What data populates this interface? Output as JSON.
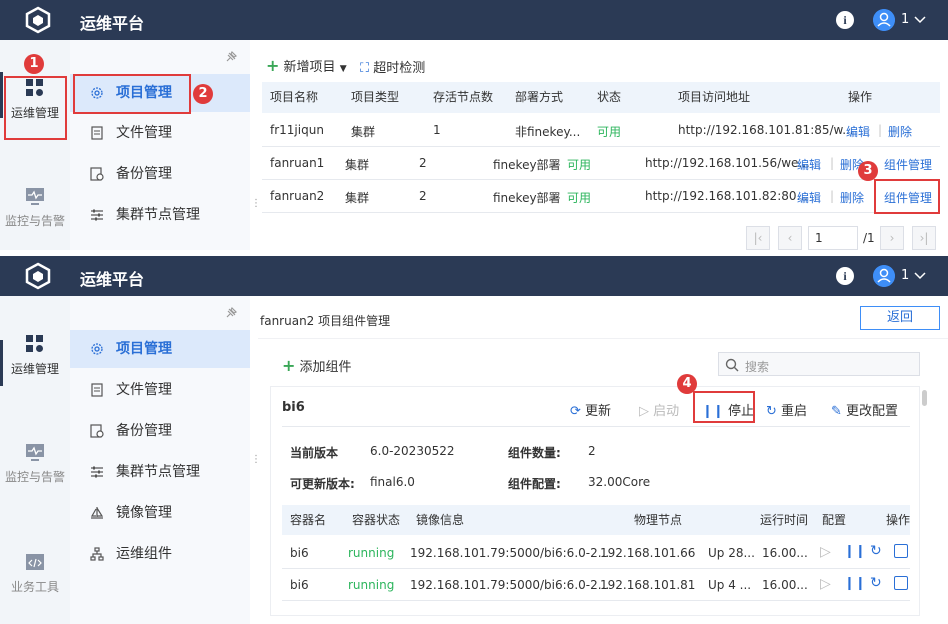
{
  "app": {
    "title": "运维平台",
    "user": "1",
    "info_icon": "info-icon",
    "avatar_icon": "user-avatar-icon"
  },
  "colors": {
    "header_bg": "#2b3a55",
    "accent": "#2a6fd6",
    "running": "#2db55d",
    "annotation": "#e03b3b"
  },
  "nav1": {
    "ops": "运维管理",
    "monitor": "监控与告警",
    "tools": "业务工具"
  },
  "nav2_top": [
    "项目管理",
    "文件管理",
    "备份管理",
    "集群节点管理"
  ],
  "nav2_bottom": [
    "项目管理",
    "文件管理",
    "备份管理",
    "集群节点管理",
    "镜像管理",
    "运维组件"
  ],
  "projects": {
    "new_label": "新增项目",
    "timeout_label": "超时检测",
    "headers": [
      "项目名称",
      "项目类型",
      "存活节点数",
      "部署方式",
      "状态",
      "项目访问地址",
      "操作"
    ],
    "rows": [
      {
        "name": "fr11jiqun",
        "type": "集群",
        "nodes": "1",
        "deploy": "非finekey...",
        "status": "可用",
        "url": "http://192.168.101.81:85/w...",
        "edit": "编辑",
        "delete": "删除"
      },
      {
        "name": "fanruan1",
        "type": "集群",
        "nodes": "2",
        "deploy": "finekey部署",
        "status": "可用",
        "url": "http://192.168.101.56/we...",
        "edit": "编辑",
        "delete": "删除",
        "component": "组件管理"
      },
      {
        "name": "fanruan2",
        "type": "集群",
        "nodes": "2",
        "deploy": "finekey部署",
        "status": "可用",
        "url": "http://192.168.101.82:80...",
        "edit": "编辑",
        "delete": "删除",
        "component": "组件管理"
      }
    ],
    "page_input": "1",
    "page_total": "/1"
  },
  "components": {
    "page_title": "fanruan2 项目组件管理",
    "back": "返回",
    "add_label": "添加组件",
    "search_placeholder": "搜索",
    "card_name": "bi6",
    "actions": {
      "update": "更新",
      "start": "启动",
      "stop": "停止",
      "restart": "重启",
      "config": "更改配置"
    },
    "info": {
      "cur_ver_label": "当前版本",
      "cur_ver": "6.0-20230522",
      "count_label": "组件数量:",
      "count": "2",
      "upd_ver_label": "可更新版本:",
      "upd_ver": "final6.0",
      "cfg_label": "组件配置:",
      "cfg": "32.00Core"
    },
    "headers": [
      "容器名",
      "容器状态",
      "镜像信息",
      "物理节点",
      "运行时间",
      "配置",
      "操作"
    ],
    "rows": [
      {
        "name": "bi6",
        "status": "running",
        "image": "192.168.101.79:5000/bi6:6.0-2...",
        "node": "192.168.101.66",
        "uptime": "Up 28...",
        "config": "16.00..."
      },
      {
        "name": "bi6",
        "status": "running",
        "image": "192.168.101.79:5000/bi6:6.0-2...",
        "node": "192.168.101.81",
        "uptime": "Up 4 ...",
        "config": "16.00..."
      }
    ]
  },
  "badges": [
    "1",
    "2",
    "3",
    "4"
  ]
}
